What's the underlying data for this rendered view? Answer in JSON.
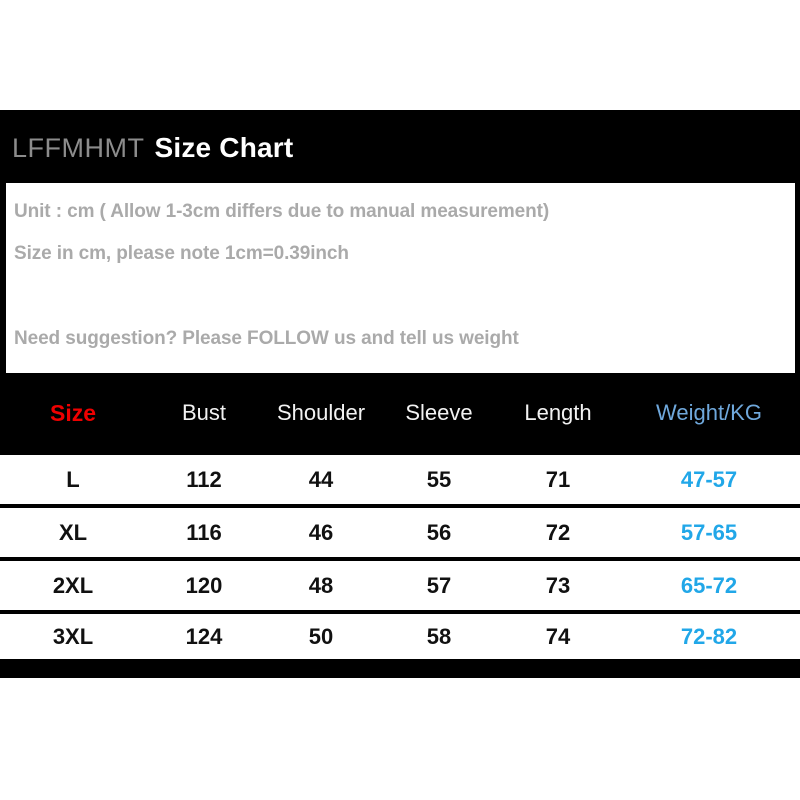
{
  "title": {
    "brand": "LFFMHMT",
    "main": "Size Chart"
  },
  "info": {
    "line1": "Unit : cm ( Allow 1-3cm differs due to manual measurement)",
    "line2": "Size in cm, please note 1cm=0.39inch",
    "line3": "Need suggestion? Please FOLLOW us and tell us weight"
  },
  "colors": {
    "panel_bg": "#000000",
    "info_bg": "#ffffff",
    "size_header": "#ee0000",
    "weight_header": "#6fa8dc",
    "weight_cell": "#21a7e8",
    "header_text": "#f2f2f2",
    "info_text": "#aaaaaa",
    "brand_text": "#8c8c8c"
  },
  "chart_data": {
    "type": "table",
    "title": "LFFMHMT Size Chart",
    "columns": [
      "Size",
      "Bust",
      "Shoulder",
      "Sleeve",
      "Length",
      "Weight/KG"
    ],
    "rows": [
      [
        "L",
        "112",
        "44",
        "55",
        "71",
        "47-57"
      ],
      [
        "XL",
        "116",
        "46",
        "56",
        "72",
        "57-65"
      ],
      [
        "2XL",
        "120",
        "48",
        "57",
        "73",
        "65-72"
      ],
      [
        "3XL",
        "124",
        "50",
        "58",
        "74",
        "72-82"
      ]
    ]
  }
}
